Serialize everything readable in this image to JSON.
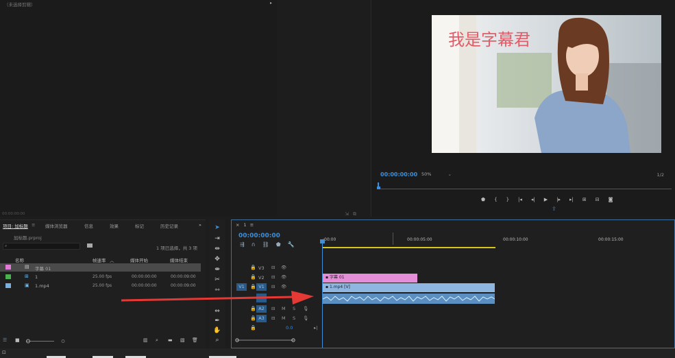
{
  "source_monitor": {
    "header": "（未选择剪辑）",
    "timecode": "00:00:00:00"
  },
  "program_monitor": {
    "subtitle": "我是字幕君",
    "timecode": "00:00:00:00",
    "zoom": "50%",
    "resolution": "1/2",
    "transport_icons": [
      "marker-icon",
      "in-point-icon",
      "out-point-icon",
      "go-to-in-icon",
      "step-back-icon",
      "play-icon",
      "step-forward-icon",
      "go-to-out-icon",
      "lift-icon",
      "extract-icon",
      "export-frame-icon"
    ],
    "accent_color": "#3d8fd9"
  },
  "project_panel": {
    "tabs": [
      "项目: 加标题",
      "媒体浏览器",
      "信息",
      "效果",
      "标记",
      "历史记录"
    ],
    "active_tab": "项目: 加标题",
    "file": "加标题.prproj",
    "search_placeholder": "",
    "selection_count": "1 项已选择，共 3 项",
    "columns": {
      "name": "名称",
      "frame_rate": "帧速率",
      "media_start": "媒体开始",
      "media_end": "媒体结束"
    },
    "rows": [
      {
        "name": "字幕 01",
        "frame_rate": "",
        "media_start": "",
        "media_end": "",
        "color": "#e07bd6",
        "icon": "title-icon",
        "selected": true
      },
      {
        "name": "1",
        "frame_rate": "25.00 fps",
        "media_start": "00:00:00:00",
        "media_end": "00:00:09:00",
        "color": "#4caf50",
        "icon": "sequence-icon",
        "selected": false
      },
      {
        "name": "1.mp4",
        "frame_rate": "25.00 fps",
        "media_start": "00:00:00:00",
        "media_end": "00:00:09:00",
        "color": "#7ab0e0",
        "icon": "video-clip-icon",
        "selected": false
      }
    ]
  },
  "timeline": {
    "tab": "1",
    "timecode": "00:00:00:00",
    "ruler_labels": [
      ":00:00",
      "00:00:05:00",
      "00:00:10:00",
      "00:00:15:00"
    ],
    "tracks": {
      "v3": "V3",
      "v2": "V2",
      "v1": "V1",
      "a2": "A2",
      "a3": "A3",
      "source_v1": "V1",
      "mute": "M",
      "solo": "S",
      "master_level": "0.0"
    },
    "clips": {
      "title_clip": "字幕 01",
      "video_clip": "1.mp4 [V]"
    },
    "colors": {
      "title_clip": "#e58ed8",
      "video_clip": "#8fb6e0",
      "audio_clip": "#5b8fc2",
      "work_area": "#d6c51d",
      "arrow": "#e53935"
    }
  }
}
